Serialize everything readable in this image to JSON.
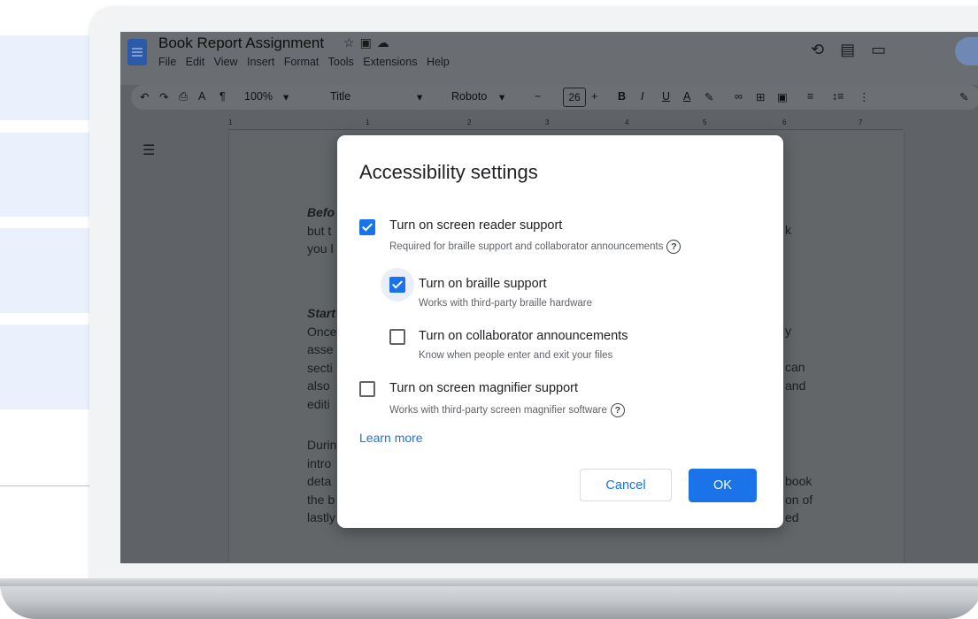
{
  "colors": {
    "accent": "#1a73e8",
    "side_panel": "#eaf1fc"
  },
  "doc": {
    "title": "Book Report Assignment",
    "title_icons": [
      "star-icon",
      "folder-move-icon",
      "cloud-status-icon"
    ],
    "menu": [
      "File",
      "Edit",
      "View",
      "Insert",
      "Format",
      "Tools",
      "Extensions",
      "Help"
    ],
    "header_icons": [
      "history-icon",
      "comments-icon",
      "meet-icon",
      "lock-icon"
    ]
  },
  "toolbar": {
    "zoom": "100%",
    "style": "Title",
    "font": "Roboto",
    "font_size": "26",
    "minus": "−",
    "plus": "+",
    "bold": "B",
    "italic": "I",
    "underline": "U",
    "text_color": "A",
    "more": "⋮"
  },
  "ruler": [
    "1",
    "1",
    "2",
    "3",
    "4",
    "5",
    "6",
    "7"
  ],
  "background_text": {
    "p1": [
      "Befo",
      "but t",
      "you l"
    ],
    "p1_right": [
      "k"
    ],
    "p2": [
      "Start",
      "Once",
      "asse",
      "secti",
      "also",
      "editi"
    ],
    "p2_right": [
      "y",
      "",
      "can",
      "and"
    ],
    "p3": [
      "Durin",
      "intro",
      "deta",
      "the b",
      "lastly"
    ],
    "p3_right": [
      "book",
      "on of",
      "ed"
    ]
  },
  "modal": {
    "title": "Accessibility settings",
    "options": [
      {
        "label": "Turn on screen reader support",
        "sub": "Required for braille support and collaborator announcements",
        "checked": true,
        "help": "?"
      },
      {
        "label": "Turn on braille support",
        "sub": "Works with third-party braille hardware",
        "checked": true
      },
      {
        "label": "Turn on collaborator announcements",
        "sub": "Know when people enter and exit your files",
        "checked": false
      },
      {
        "label": "Turn on screen magnifier support",
        "sub": "Works with third-party screen magnifier software",
        "checked": false,
        "help": "?"
      }
    ],
    "learn_more": "Learn more",
    "cancel": "Cancel",
    "ok": "OK"
  }
}
